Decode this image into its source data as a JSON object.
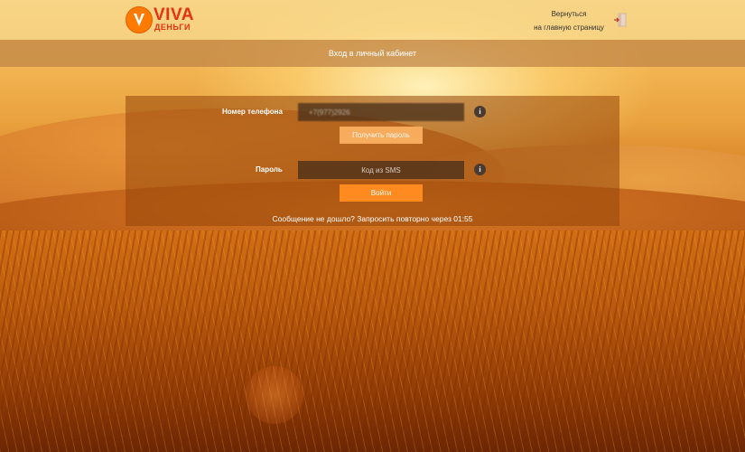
{
  "brand": {
    "name_line1": "VIVA",
    "name_line2": "ДЕНЬГИ",
    "accent_color": "#ff7a00",
    "text_color": "#e53210"
  },
  "header": {
    "back_link_line1": "Вернуться",
    "back_link_line2": "на главную страницу",
    "exit_icon": "exit-door-icon"
  },
  "titlebar": {
    "title": "Вход в личный кабинет"
  },
  "login": {
    "phone_label": "Номер телефона",
    "phone_value": "+7(977)2926",
    "get_password_button": "Получить пароль",
    "password_label": "Пароль",
    "password_placeholder": "Код из SMS",
    "login_button": "Войти",
    "info_icon_glyph": "i",
    "resend_text": "Сообщение не дошло? Запросить повторно через 01:55"
  }
}
